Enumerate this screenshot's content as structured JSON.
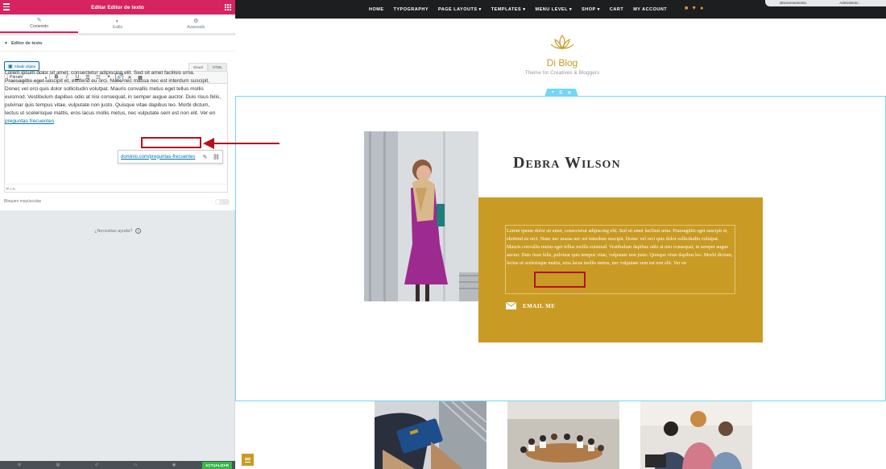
{
  "panel": {
    "title": "Editar Editor de texto",
    "tabs": [
      {
        "label": "Contenido",
        "icon": "pencil-icon"
      },
      {
        "label": "Estilo",
        "icon": "half-circle-icon"
      },
      {
        "label": "Avanzado",
        "icon": "gear-icon"
      }
    ],
    "section_title": "Editor de texto",
    "add_media_label": "Añadir objeto",
    "mode_tabs": [
      "Visual",
      "HTML"
    ],
    "format_select": "Párrafo",
    "editor_text": "Lorem ipsum dolor sit amet, consectetur adipiscing elit. Sed sit amet facilisis urna. Praesagittis eget suscipit et, eleifend eu orci. Nunc nec massa nec est interdum suscipit. Donec vel orci quis dolor sollicitudin volutpat. Mauris convallis metus eget tellus mollis euismod. Vestibulum dapibus odio at nisi consequat, in semper augue auctor. Duis risus felis, pulvinar quis tempus vitae, vulputate non justo. Quisque vitae dapibus leo. Morbi dictum, lectus ut scelerisque mattis, eros lacus mollis metus, nec vulputate sem est non elit. Ver en",
    "link_text": "preguntas frecuentes",
    "link_url": "dominio.com/preguntas-frecuentes",
    "status_path": "P » A",
    "caps_label": "Bloqueo mayúsculas",
    "toggle_label": "",
    "help_text": "¿Necesitas ayuda?",
    "update_label": "ACTUALIZAR"
  },
  "site": {
    "nav": [
      "HOME",
      "TYPOGRAPHY",
      "PAGE LAYOUTS ▾",
      "TEMPLATES ▾",
      "MENU LEVEL ▾",
      "SHOP ▾",
      "CART",
      "MY ACCOUNT"
    ],
    "admin_left": "almacenamiento.",
    "admin_right": "Administrar...",
    "logo_title": "Di Blog",
    "logo_subtitle": "Theme for Creatives & Bloggers",
    "person_name": "Debra Wilson",
    "bio_text": "Lorem ipsum dolor sit amet, consectetur adipiscing elit. Sed sit amet facilisis urna. Praesagittis eget suscipit et, eleifend eu orci. Nunc nec massa nec est interdum suscipit. Donec vel orci quis dolor sollicitudin volutpat. Mauris convallis metus eget tellus mollis euismod. Vestibulum dapibus odio at nisi consequat, in semper augue auctor. Duis risus felis, pulvinar quis tempus vitae, vulputate non justo. Quisque vitae dapibus leo. Morbi dictum, lectus ut scelerisque mattis, eros lacus mollis metus, nec vulputate sem est non elit. Ver en",
    "email_label": "EMAIL ME"
  },
  "colors": {
    "elementor_pink": "#d5245f",
    "gold": "#c99b25",
    "nav_dark": "#1d1e20",
    "highlight_red": "#b5121b",
    "section_cyan": "#71d7f7"
  }
}
